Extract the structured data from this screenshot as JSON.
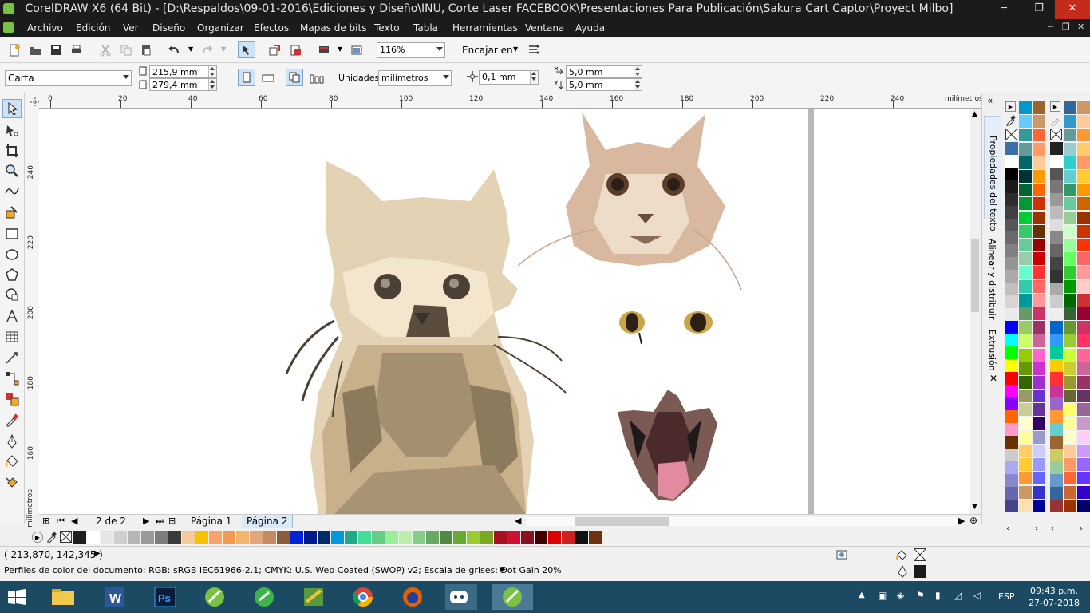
{
  "window": {
    "title": "CorelDRAW X6 (64 Bit) - [D:\\Respaldos\\09-01-2016\\Ediciones y Diseño\\INU, Corte Laser FACEBOOK\\Presentaciones Para Publicación\\Sakura Cart Captor\\Proyect Milbo]",
    "minimize": "─",
    "maximize": "❐",
    "close": "✕"
  },
  "menu": {
    "items": [
      "Archivo",
      "Edición",
      "Ver",
      "Diseño",
      "Organizar",
      "Efectos",
      "Mapas de bits",
      "Texto",
      "Tabla",
      "Herramientas",
      "Ventana",
      "Ayuda"
    ],
    "doc_controls": [
      "─",
      "❐",
      "✕"
    ]
  },
  "standard_toolbar": {
    "zoom": "116%",
    "snap_label": "Encajar en"
  },
  "property_bar": {
    "paper_size": "Carta",
    "width": "215,9 mm",
    "height": "279,4 mm",
    "units_label": "Unidades:",
    "units_value": "milímetros",
    "nudge": "0,1 mm",
    "dup_x": "5,0 mm",
    "dup_y": "5,0 mm"
  },
  "ruler": {
    "h_labels": [
      "0",
      "20",
      "40",
      "60",
      "80",
      "100",
      "120",
      "140",
      "160",
      "180",
      "200",
      "220",
      "240"
    ],
    "unit": "milímetros",
    "v_labels": [
      "240",
      "220",
      "200",
      "180",
      "160"
    ],
    "v_unit": "milímetros"
  },
  "page_nav": {
    "counter": "2 de 2",
    "tabs": [
      "Página 1",
      "Página 2"
    ],
    "active_tab": "Página 2"
  },
  "dockers": {
    "tabs": [
      "Propiedades del texto",
      "Alinear y distribuir",
      "Extrusión"
    ]
  },
  "status": {
    "coords": "( 213,870, 142,345 )",
    "color_profile": "Perfiles de color del documento: RGB: sRGB IEC61966-2.1; CMYK: U.S. Web Coated (SWOP) v2; Escala de grises: Dot Gain 20%"
  },
  "document_palette": [
    "#1e1e1e",
    "#ffffff",
    "#e6e6e6",
    "#cfcfcf",
    "#b5b5b5",
    "#9a9a9a",
    "#7c7c7c",
    "#3a3a3a",
    "#f6c99a",
    "#f6c100",
    "#f7a36b",
    "#f29a52",
    "#f5b46c",
    "#e2a67c",
    "#c38b5f",
    "#8a5c3a",
    "#0022dd",
    "#001a8c",
    "#002a66",
    "#0099dd",
    "#22aa88",
    "#44dd99",
    "#66cc88",
    "#99ee99",
    "#bbeeaa",
    "#88cc88",
    "#66aa66",
    "#558844",
    "#66aa33",
    "#99cc33",
    "#77aa22",
    "#aa1122",
    "#cc1133",
    "#881122",
    "#440000",
    "#dd0000",
    "#cc2222",
    "#111111",
    "#6b3311"
  ],
  "color_palette": {
    "col1": [
      "#3c6ea8",
      "#ffffff",
      "#000000",
      "#1a1a1a",
      "#2d2d2d",
      "#404040",
      "#555555",
      "#6a6a6a",
      "#808080",
      "#959595",
      "#aaaaaa",
      "#c0c0c0",
      "#d5d5d5",
      "#eaeaea",
      "#0000ff",
      "#00ffff",
      "#00ff00",
      "#ffff00",
      "#ff0000",
      "#ff00ff",
      "#8800ff",
      "#ff6600",
      "#ff99cc",
      "#663300",
      "#cccccc",
      "#aaaaee",
      "#8888cc",
      "#6666aa",
      "#444488",
      "#222266"
    ],
    "col2": [
      "#0099cc",
      "#66ccff",
      "#339999",
      "#669999",
      "#006666",
      "#003333",
      "#006633",
      "#009933",
      "#00cc33",
      "#33cc66",
      "#66cc99",
      "#99ccaa",
      "#66ffcc",
      "#33ccaa",
      "#009999",
      "#669966",
      "#99cc66",
      "#ccff66",
      "#99cc00",
      "#669900",
      "#336600",
      "#999966",
      "#cccc99",
      "#ffffcc",
      "#ffff99",
      "#ffcc66",
      "#ffcc33",
      "#ff9933",
      "#cc9966",
      "#ffe0b0"
    ],
    "col3": [
      "#996633",
      "#cc9966",
      "#ff6633",
      "#ff9966",
      "#ffcc99",
      "#ff9900",
      "#ff6600",
      "#cc3300",
      "#993300",
      "#663300",
      "#990000",
      "#cc0000",
      "#ff3333",
      "#ff6666",
      "#ff9999",
      "#cc3366",
      "#993366",
      "#cc6699",
      "#ff66cc",
      "#cc33cc",
      "#9933cc",
      "#6633cc",
      "#663399",
      "#330066",
      "#9999cc",
      "#ccccff",
      "#9999ff",
      "#6666ff",
      "#3333cc",
      "#000099"
    ],
    "col4": [
      "#222222",
      "#ffffff",
      "#555555",
      "#777777",
      "#999999",
      "#bbbbbb",
      "#dddddd",
      "#888888",
      "#666666",
      "#444444",
      "#333333",
      "#aaaaaa",
      "#cccccc",
      "#eeeeee",
      "#0066cc",
      "#3399ff",
      "#00cc99",
      "#ffcc00",
      "#ff3333",
      "#cc3399",
      "#9966cc",
      "#ff9933",
      "#66cccc",
      "#996633",
      "#cccc66",
      "#99cc99",
      "#6699cc",
      "#336699",
      "#993333",
      "#663366"
    ],
    "col5": [
      "#336699",
      "#3399cc",
      "#669999",
      "#99cccc",
      "#33cccc",
      "#66cccc",
      "#339966",
      "#66cc99",
      "#99cc99",
      "#ccffcc",
      "#99ff99",
      "#66ff66",
      "#33cc33",
      "#009900",
      "#006600",
      "#336633",
      "#669933",
      "#99cc33",
      "#ccff33",
      "#cccc33",
      "#999933",
      "#666633",
      "#ffff66",
      "#ffff99",
      "#ffffcc",
      "#ffcc99",
      "#ff9966",
      "#ff6633",
      "#cc6633",
      "#993300"
    ],
    "col6": [
      "#cc9966",
      "#ffcc99",
      "#ff9933",
      "#ffcc66",
      "#ff9966",
      "#ffcc33",
      "#ff9900",
      "#cc6600",
      "#993300",
      "#cc3300",
      "#ff3300",
      "#ff6666",
      "#ff9999",
      "#ffcccc",
      "#cc3333",
      "#990033",
      "#cc3366",
      "#ff3366",
      "#ff6699",
      "#cc6699",
      "#993366",
      "#663366",
      "#996699",
      "#cc99cc",
      "#ffccff",
      "#cc99ff",
      "#9966ff",
      "#6633ff",
      "#3300cc",
      "#000066"
    ]
  },
  "clock": {
    "time": "09:43 p.m.",
    "date": "27-07-2018",
    "lang": "ESP"
  }
}
